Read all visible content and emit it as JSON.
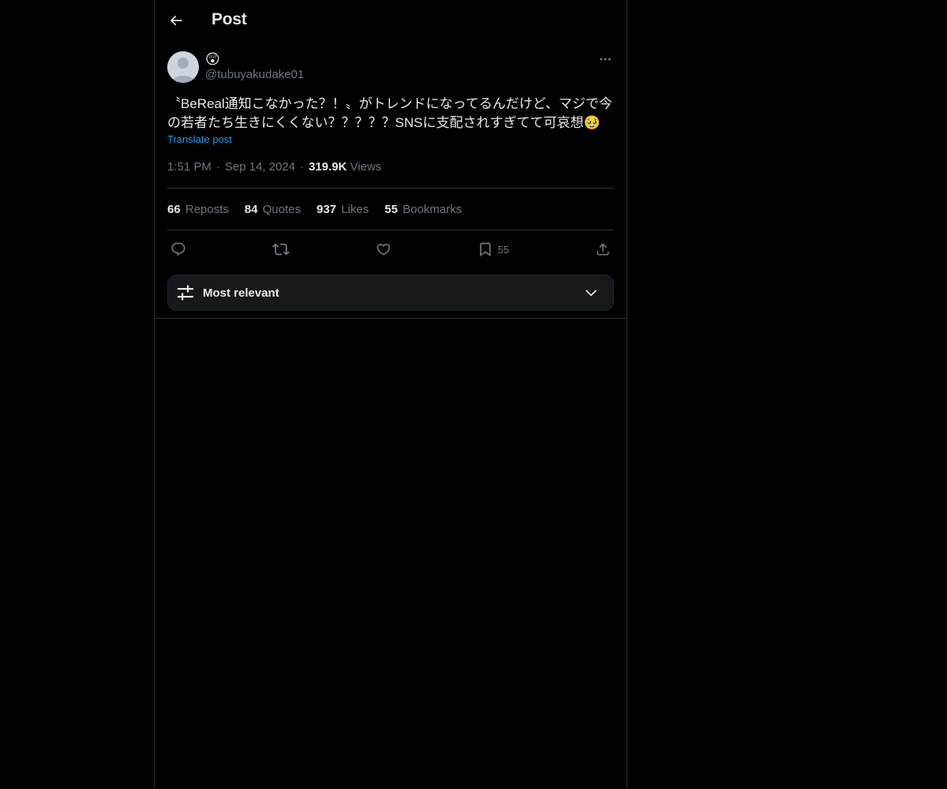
{
  "header": {
    "title": "Post"
  },
  "post": {
    "author": {
      "display_name": "😲",
      "handle": "@tubuyakudake01"
    },
    "text": "〝BeReal通知こなかった？！〟がトレンドになってるんだけど、マジで今の若者たち生きにくくない？？？？？SNSに支配されすぎてて可哀想",
    "text_emoji": "🥹",
    "translate_label": "Translate post",
    "time": "1:51 PM",
    "date": "Sep 14, 2024",
    "views_count": "319.9K",
    "views_label": "Views",
    "separator": "·"
  },
  "stats": [
    {
      "count": "66",
      "label": "Reposts"
    },
    {
      "count": "84",
      "label": "Quotes"
    },
    {
      "count": "937",
      "label": "Likes"
    },
    {
      "count": "55",
      "label": "Bookmarks"
    }
  ],
  "actions": {
    "reply_icon": "reply-icon",
    "repost_icon": "repost-icon",
    "like_icon": "heart-icon",
    "bookmark_icon": "bookmark-icon",
    "bookmark_count": "55",
    "share_icon": "share-icon"
  },
  "sort": {
    "label": "Most relevant",
    "icon": "sliders-icon"
  },
  "colors": {
    "background": "#000000",
    "text_primary": "#e7e9ea",
    "text_secondary": "#71767b",
    "accent": "#1d9bf0",
    "divider": "#2f3336"
  }
}
